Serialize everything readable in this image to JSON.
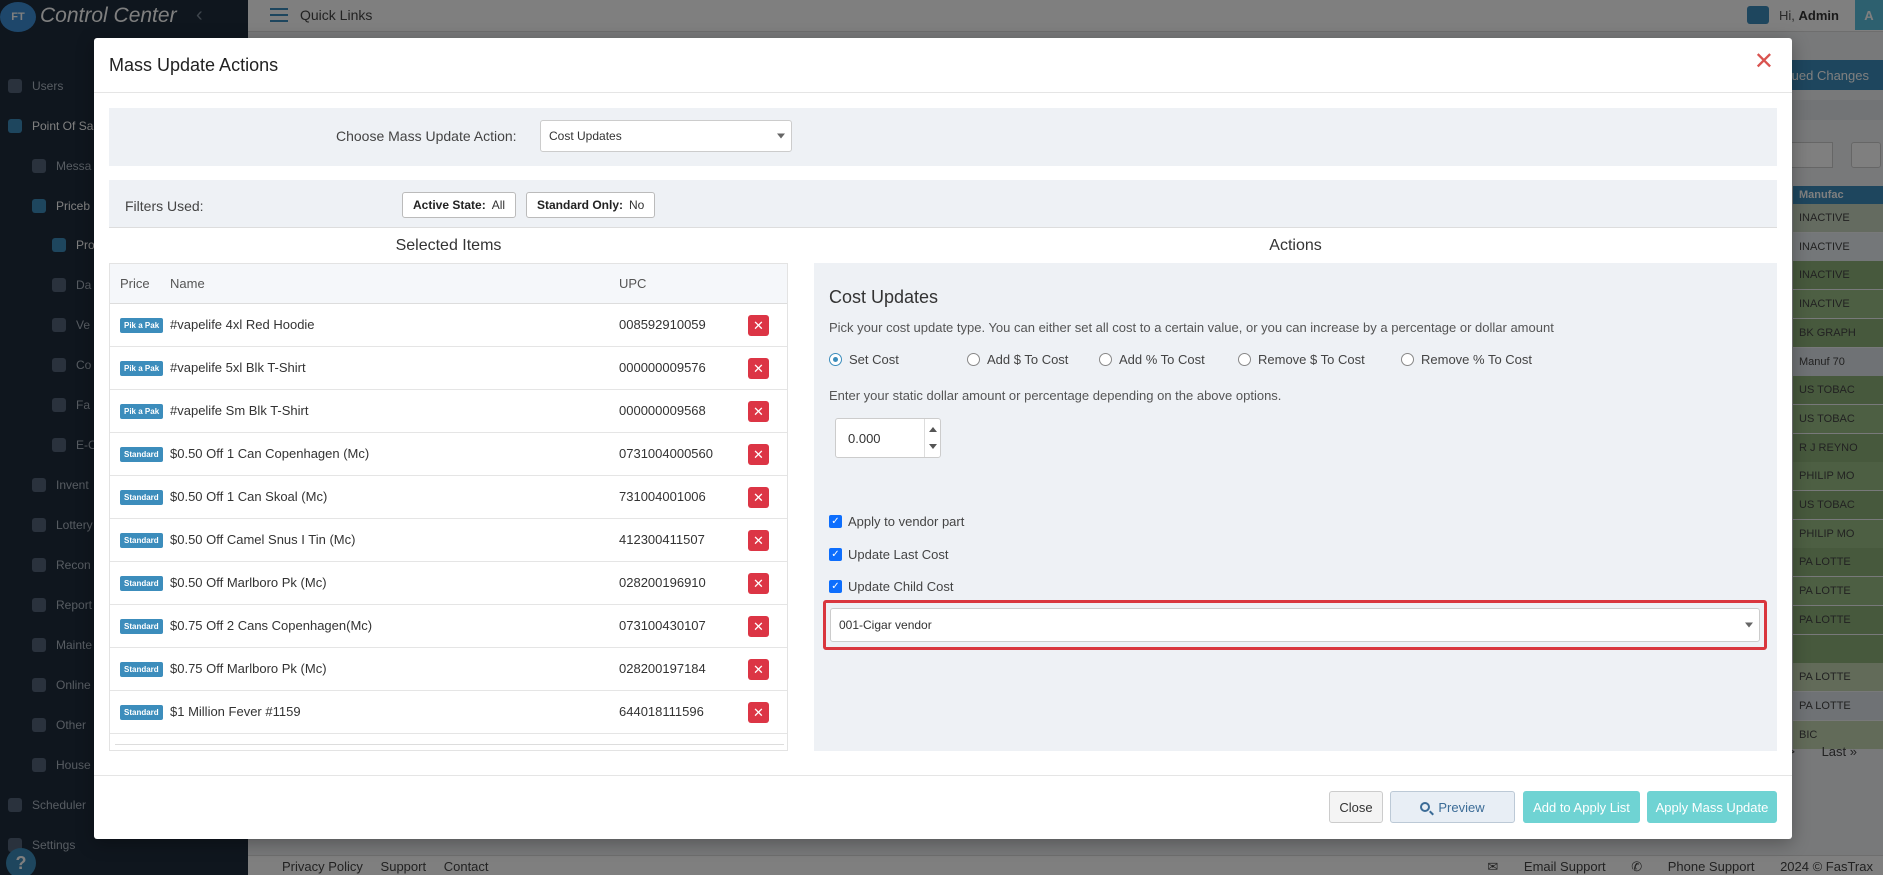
{
  "app": {
    "brand": "Control Center",
    "logo_text": "FT",
    "quick_links": "Quick Links",
    "greeting": "Hi,",
    "user": "Admin",
    "avatar_letter": "A"
  },
  "sidebar": {
    "items": [
      {
        "label": "Users"
      },
      {
        "label": "Point Of Sal"
      },
      {
        "label": "Messa"
      },
      {
        "label": "Priceb"
      },
      {
        "label": "Pro"
      },
      {
        "label": "Da"
      },
      {
        "label": "Ve"
      },
      {
        "label": "Co"
      },
      {
        "label": "Fa"
      },
      {
        "label": "E-C"
      },
      {
        "label": "Invent"
      },
      {
        "label": "Lottery"
      },
      {
        "label": "Recon"
      },
      {
        "label": "Report"
      },
      {
        "label": "Mainte"
      },
      {
        "label": "Online"
      },
      {
        "label": "Other"
      },
      {
        "label": "House"
      },
      {
        "label": "Scheduler"
      },
      {
        "label": "Settings"
      }
    ],
    "help": "?"
  },
  "background": {
    "queued_changes": "ued Changes",
    "column_header": "Manufac",
    "column_cells": [
      "INACTIVE",
      "INACTIVE",
      "INACTIVE",
      "INACTIVE",
      "BK GRAPH",
      "Manuf 70",
      "US TOBAC",
      "US TOBAC",
      "R J REYNO",
      "PHILIP MO",
      "US TOBAC",
      "PHILIP MO",
      "PA LOTTE",
      "PA LOTTE",
      "PA LOTTE",
      "",
      "PA LOTTE",
      "PA LOTTE",
      "BIC"
    ],
    "pager_prev": ">",
    "pager_last": "Last »"
  },
  "footer": {
    "links": [
      "Privacy Policy",
      "Support",
      "Contact"
    ],
    "email_support": "Email Support",
    "phone_support": "Phone Support",
    "copyright": "2024 © FasTrax"
  },
  "modal": {
    "title": "Mass Update Actions",
    "close_glyph": "✕",
    "action_label": "Choose Mass Update Action:",
    "action_value": "Cost Updates",
    "filters_label": "Filters Used:",
    "filters": [
      {
        "key": "Active State:",
        "value": "All"
      },
      {
        "key": "Standard Only:",
        "value": "No"
      }
    ],
    "selected_title": "Selected Items",
    "actions_title": "Actions",
    "columns": {
      "price": "Price",
      "name": "Name",
      "upc": "UPC"
    },
    "items": [
      {
        "badge": "Pik a Pak",
        "name": "#vapelife 4xl Red Hoodie",
        "upc": "008592910059"
      },
      {
        "badge": "Pik a Pak",
        "name": "#vapelife 5xl Blk T-Shirt",
        "upc": "000000009576"
      },
      {
        "badge": "Pik a Pak",
        "name": "#vapelife Sm Blk T-Shirt",
        "upc": "000000009568"
      },
      {
        "badge": "Standard",
        "name": "$0.50 Off 1 Can Copenhagen (Mc)",
        "upc": "0731004000560"
      },
      {
        "badge": "Standard",
        "name": "$0.50 Off 1 Can Skoal (Mc)",
        "upc": "731004001006"
      },
      {
        "badge": "Standard",
        "name": "$0.50 Off Camel Snus I Tin (Mc)",
        "upc": "412300411507"
      },
      {
        "badge": "Standard",
        "name": "$0.50 Off Marlboro Pk (Mc)",
        "upc": "028200196910"
      },
      {
        "badge": "Standard",
        "name": "$0.75 Off 2 Cans Copenhagen(Mc)",
        "upc": "073100430107"
      },
      {
        "badge": "Standard",
        "name": "$0.75 Off Marlboro Pk (Mc)",
        "upc": "028200197184"
      },
      {
        "badge": "Standard",
        "name": "$1 Million Fever #1159",
        "upc": "644018111596"
      }
    ],
    "cost": {
      "title": "Cost Updates",
      "description": "Pick your cost update type. You can either set all cost to a certain value, or you can increase by a percentage or dollar amount",
      "options": [
        {
          "label": "Set Cost",
          "selected": true
        },
        {
          "label": "Add $ To Cost",
          "selected": false
        },
        {
          "label": "Add % To Cost",
          "selected": false
        },
        {
          "label": "Remove $ To Cost",
          "selected": false
        },
        {
          "label": "Remove % To Cost",
          "selected": false
        }
      ],
      "amount_prompt": "Enter your static dollar amount or percentage depending on the above options.",
      "amount_value": "0.000",
      "checks": [
        {
          "label": "Apply to vendor part",
          "checked": true
        },
        {
          "label": "Update Last Cost",
          "checked": true
        },
        {
          "label": "Update Child Cost",
          "checked": true
        }
      ],
      "vendor_value": "001-Cigar vendor"
    },
    "buttons": {
      "close": "Close",
      "preview": "Preview",
      "add_to_apply": "Add to Apply List",
      "apply": "Apply Mass Update"
    }
  }
}
